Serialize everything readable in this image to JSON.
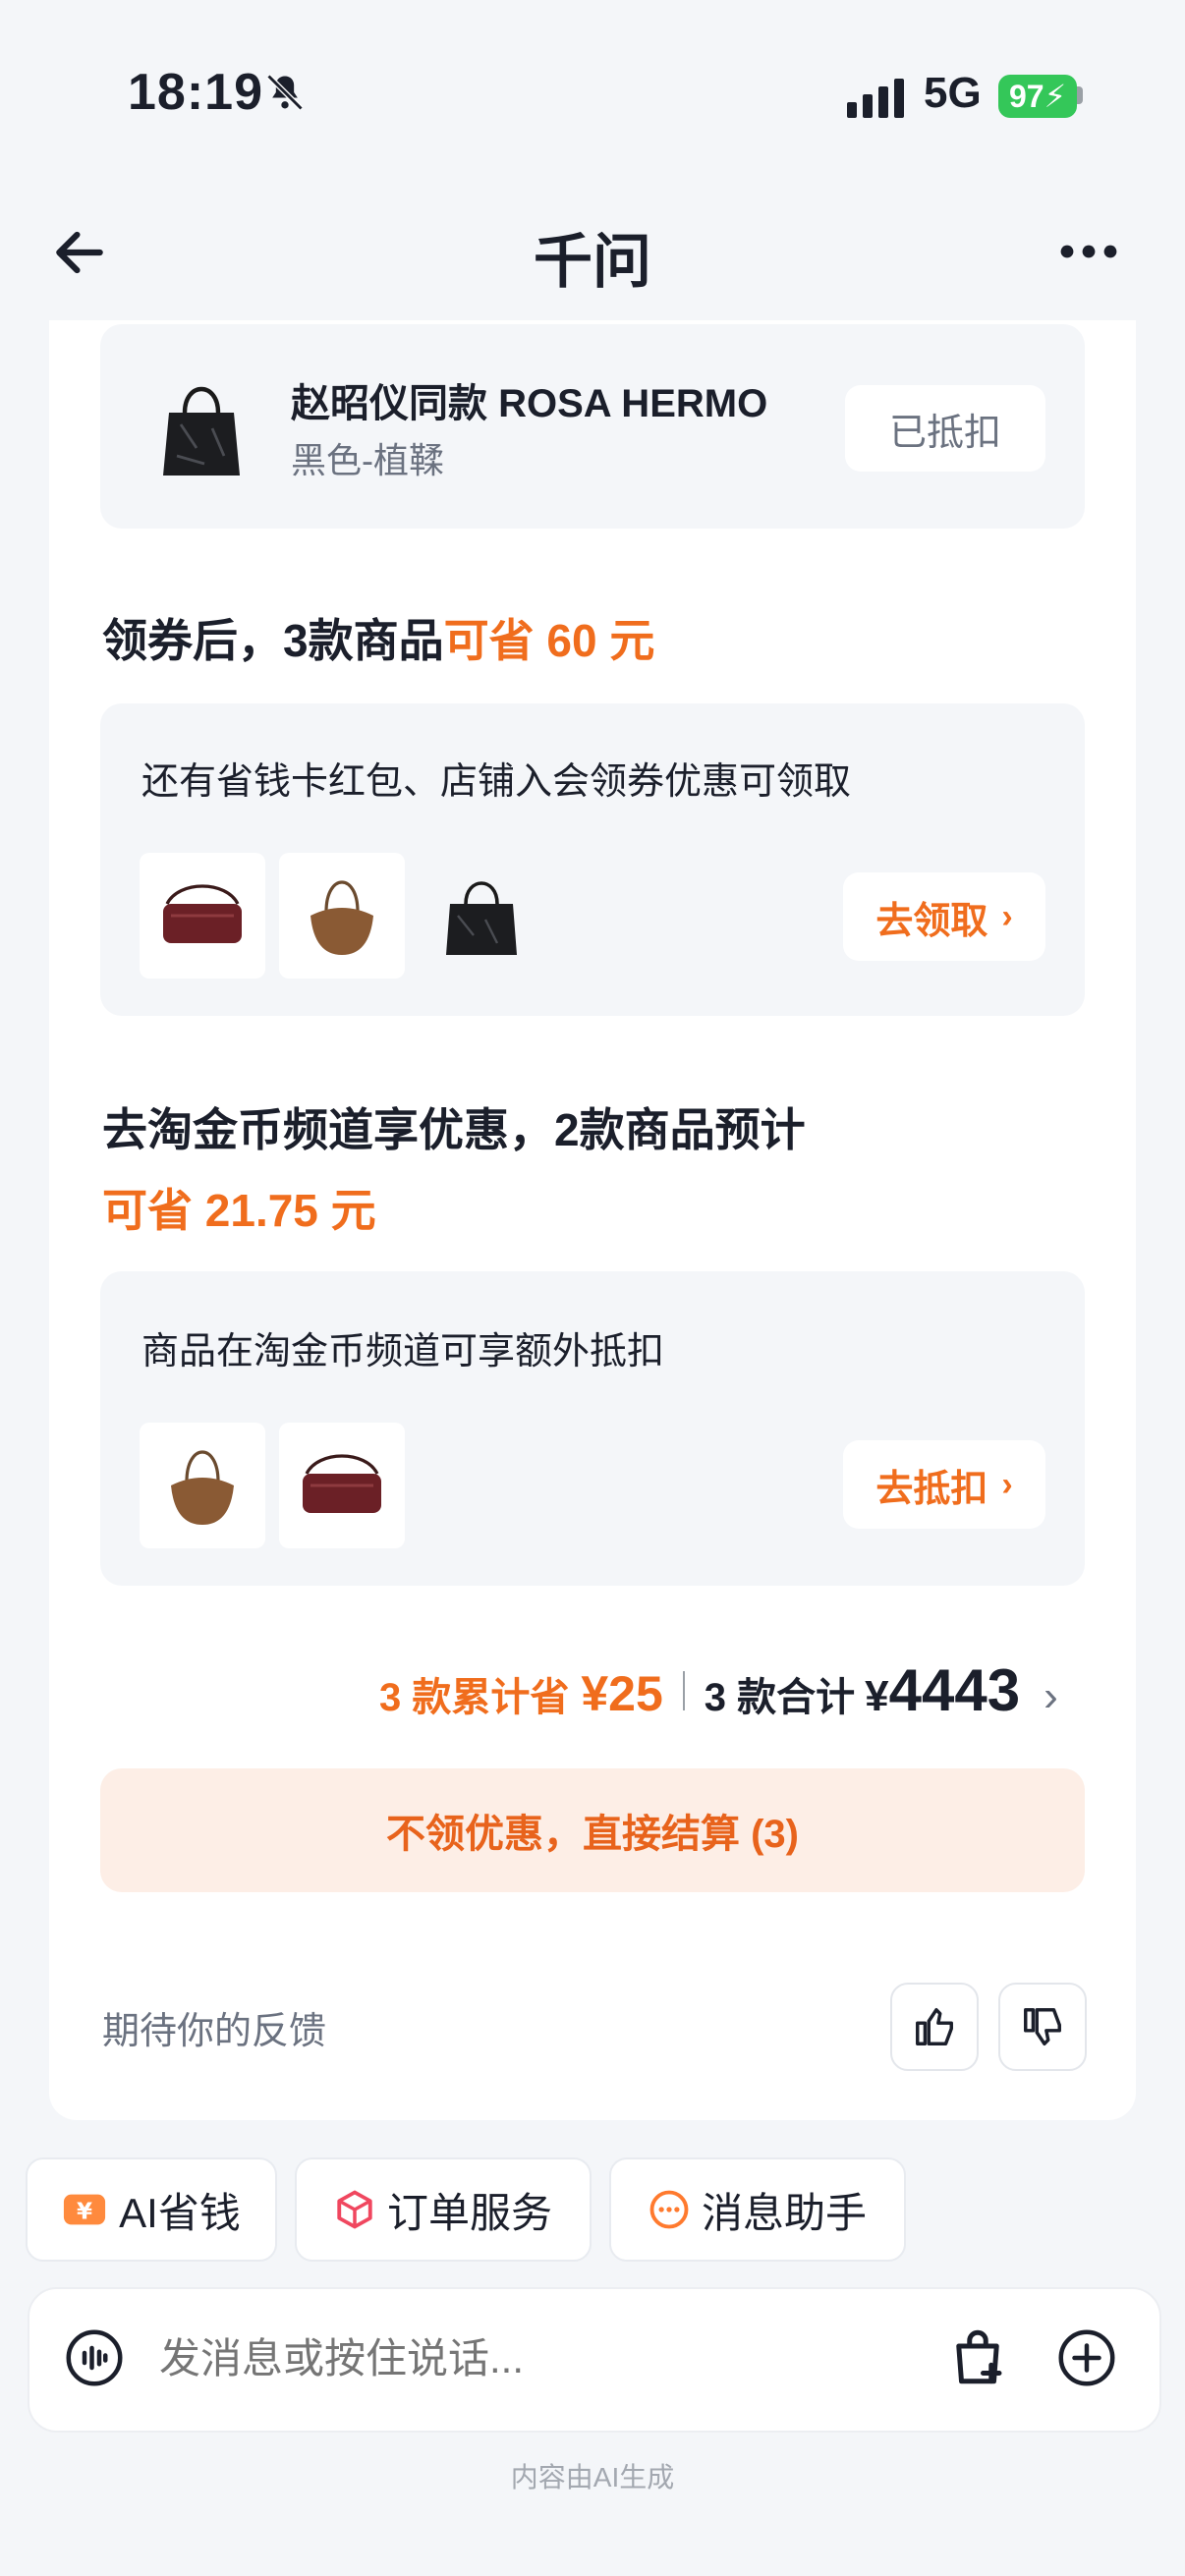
{
  "status": {
    "time": "18:19",
    "network": "5G",
    "battery": "97"
  },
  "nav": {
    "title": "千问"
  },
  "product": {
    "name": "赵昭仪同款 ROSA HERMO",
    "variant": "黑色-植鞣",
    "status_btn": "已抵扣"
  },
  "coupon": {
    "heading_prefix": "领券后，3款商品",
    "heading_highlight": "可省 60 元",
    "desc": "还有省钱卡红包、店铺入会领券优惠可领取",
    "button": "去领取",
    "thumbs": [
      "maroon-bag",
      "brown-hobo-bag",
      "black-tote-bag"
    ]
  },
  "coins": {
    "heading_line1": "去淘金币频道享优惠，2款商品预计",
    "heading_line2": "可省 21.75 元",
    "desc": "商品在淘金币频道可享额外抵扣",
    "button": "去抵扣",
    "thumbs": [
      "brown-hobo-bag",
      "maroon-bag"
    ]
  },
  "summary": {
    "saved_label": "3 款累计省",
    "saved_value": "¥25",
    "total_label": "3 款合计",
    "total_currency": "¥",
    "total_value": "4443"
  },
  "checkout": {
    "label": "不领优惠，直接结算 (3)"
  },
  "feedback": {
    "label": "期待你的反馈"
  },
  "chips": [
    {
      "label": "AI省钱",
      "icon": "yen-ticket-icon"
    },
    {
      "label": "订单服务",
      "icon": "package-box-icon"
    },
    {
      "label": "消息助手",
      "icon": "chat-bubble-icon"
    }
  ],
  "input": {
    "placeholder": "发消息或按住说话..."
  },
  "footer": {
    "note": "内容由AI生成"
  },
  "colors": {
    "accent": "#f06d1d",
    "checkout_bg": "#fdeee6",
    "battery": "#34c759"
  }
}
